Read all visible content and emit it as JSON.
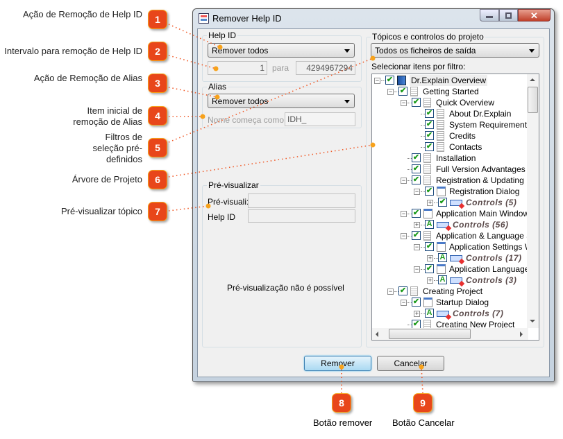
{
  "callouts": [
    {
      "n": "1",
      "label": "Ação de Remoção de Help ID"
    },
    {
      "n": "2",
      "label": "Intervalo para remoção de Help ID"
    },
    {
      "n": "3",
      "label": "Ação de Remoção de Alias"
    },
    {
      "n": "4",
      "label": "Item inicial de remoção de Alias"
    },
    {
      "n": "5",
      "label": "Filtros de seleção pré-definidos"
    },
    {
      "n": "6",
      "label": "Árvore de Projeto"
    },
    {
      "n": "7",
      "label": "Pré-visualizar tópico"
    },
    {
      "n": "8",
      "label": "Botão remover"
    },
    {
      "n": "9",
      "label": "Botão Cancelar"
    }
  ],
  "colors": {
    "badge": "#e8461a",
    "leader": "#f05a28",
    "dot": "#f7a21b",
    "remove_button": "#bfe3f7"
  },
  "window": {
    "title": "Remover Help ID"
  },
  "help_id": {
    "group": "Help ID",
    "action": "Remover todos",
    "from": "1",
    "to_label": "para",
    "to": "4294967294"
  },
  "alias": {
    "group": "Alias",
    "action": "Remover todos",
    "starts_label": "Nome começa como",
    "starts_value": "IDH_"
  },
  "preview": {
    "group": "Pré-visualizar",
    "preview_label": "Pré-visuali:",
    "preview_value": "",
    "helpid_label": "Help ID",
    "helpid_value": "",
    "message": "Pré-visualização não é possível"
  },
  "topics": {
    "group": "Tópicos e controlos do projeto",
    "filter": "Todos os ficheiros de saída",
    "filter_label": "Selecionar itens por filtro:",
    "tree": [
      {
        "level": 0,
        "exp": "-",
        "chk": "check",
        "icon": "book",
        "label": "Dr.Explain Overview"
      },
      {
        "level": 1,
        "exp": "-",
        "chk": "check",
        "icon": "page",
        "label": "Getting Started"
      },
      {
        "level": 2,
        "exp": "-",
        "chk": "check",
        "icon": "page",
        "label": "Quick Overview"
      },
      {
        "level": 3,
        "exp": "",
        "chk": "check",
        "icon": "page",
        "label": "About Dr.Explain"
      },
      {
        "level": 3,
        "exp": "",
        "chk": "check",
        "icon": "page",
        "label": "System Requirements"
      },
      {
        "level": 3,
        "exp": "",
        "chk": "check",
        "icon": "page",
        "label": "Credits"
      },
      {
        "level": 3,
        "exp": "",
        "chk": "check",
        "icon": "page",
        "label": "Contacts"
      },
      {
        "level": 2,
        "exp": "",
        "chk": "check",
        "icon": "page",
        "label": "Installation"
      },
      {
        "level": 2,
        "exp": "",
        "chk": "check",
        "icon": "page",
        "label": "Full Version Advantages"
      },
      {
        "level": 2,
        "exp": "-",
        "chk": "check",
        "icon": "page",
        "label": "Registration & Updating"
      },
      {
        "level": 3,
        "exp": "-",
        "chk": "check",
        "icon": "window",
        "label": "Registration Dialog"
      },
      {
        "level": 4,
        "exp": "+",
        "chk": "check",
        "icon": "controls",
        "label": "Controls (5)",
        "italic": true
      },
      {
        "level": 2,
        "exp": "-",
        "chk": "check",
        "icon": "window",
        "label": "Application Main Window"
      },
      {
        "level": 3,
        "exp": "+",
        "chk": "A",
        "icon": "controls",
        "label": "Controls (56)",
        "italic": true
      },
      {
        "level": 2,
        "exp": "-",
        "chk": "check",
        "icon": "page",
        "label": "Application & Language Se"
      },
      {
        "level": 3,
        "exp": "-",
        "chk": "check",
        "icon": "window",
        "label": "Application Settings W"
      },
      {
        "level": 4,
        "exp": "+",
        "chk": "A",
        "icon": "controls",
        "label": "Controls (17)",
        "italic": true
      },
      {
        "level": 3,
        "exp": "-",
        "chk": "check",
        "icon": "window",
        "label": "Application Language"
      },
      {
        "level": 4,
        "exp": "+",
        "chk": "A",
        "icon": "controls",
        "label": "Controls (3)",
        "italic": true
      },
      {
        "level": 1,
        "exp": "-",
        "chk": "check",
        "icon": "page",
        "label": "Creating Project"
      },
      {
        "level": 2,
        "exp": "-",
        "chk": "check",
        "icon": "window",
        "label": "Startup Dialog"
      },
      {
        "level": 3,
        "exp": "+",
        "chk": "A",
        "icon": "controls",
        "label": "Controls (7)",
        "italic": true
      },
      {
        "level": 2,
        "exp": "",
        "chk": "check",
        "icon": "page",
        "label": "Creating New Project"
      }
    ]
  },
  "buttons": {
    "remove": "Remover",
    "cancel": "Cancelar"
  }
}
